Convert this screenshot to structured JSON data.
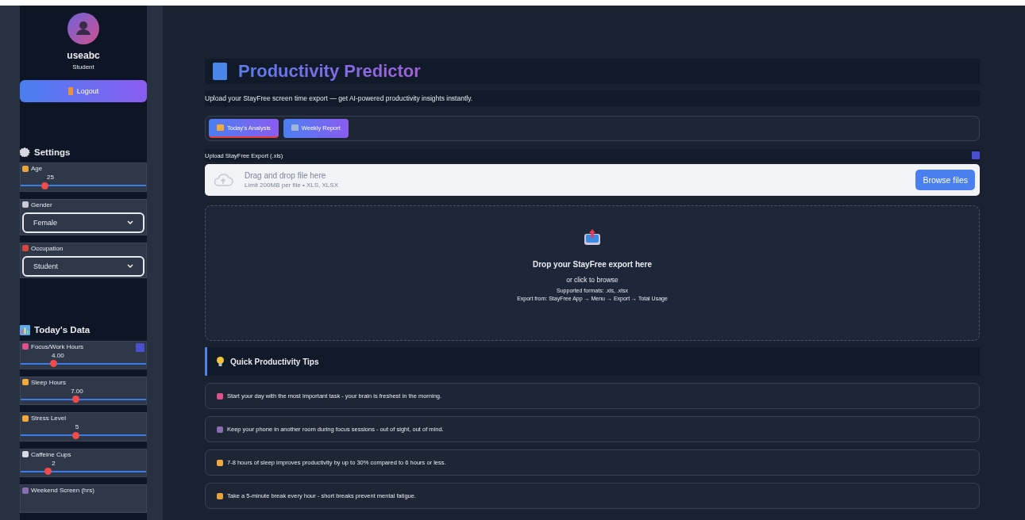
{
  "sidebar": {
    "user": {
      "name": "useabc",
      "role": "Student"
    },
    "logout": "Logout",
    "settings": {
      "title": "Settings",
      "fields": [
        {
          "kind": "slider",
          "label": "Age",
          "reading": "25",
          "level": 0.19
        },
        {
          "kind": "select",
          "label": "Gender",
          "value": "Female"
        },
        {
          "kind": "select",
          "label": "Occupation",
          "value": "Student"
        }
      ]
    },
    "today": {
      "title": "Today's Data",
      "fields": [
        {
          "kind": "slider",
          "label": "Focus/Work Hours",
          "reading": "4.00",
          "level": 0.26,
          "help": true
        },
        {
          "kind": "slider",
          "label": "Sleep Hours",
          "reading": "7.00",
          "level": 0.44
        },
        {
          "kind": "slider",
          "label": "Stress Level",
          "reading": "5",
          "level": 0.44
        },
        {
          "kind": "slider",
          "label": "Caffeine Cups",
          "reading": "2",
          "level": 0.22
        },
        {
          "kind": "slider",
          "label": "Weekend Screen (hrs)"
        }
      ]
    }
  },
  "main": {
    "title": "Productivity Predictor",
    "subtitle": "Upload your StayFree screen time export — get AI-powered productivity insights instantly.",
    "tabs": [
      {
        "label": "Today's Analysis",
        "selected": true
      },
      {
        "label": "Weekly Report",
        "selected": false
      }
    ],
    "uploader": {
      "label": "Upload StayFree Export (.xls)",
      "hint": "Drag and drop file here",
      "limit": "Limit 200MB per file • XLS, XLSX",
      "button": "Browse files"
    },
    "dropzone": {
      "title": "Drop your StayFree export here",
      "sub": "or click to browse",
      "formats": "Supported formats: .xls, .xlsx",
      "source": "Export from: StayFree App → Menu → Export → Total Usage"
    },
    "tips": {
      "title": "Quick Productivity Tips",
      "items": [
        "Start your day with the most important task - your brain is freshest in the morning.",
        "Keep your phone in another room during focus sessions - out of sight, out of mind.",
        "7-8 hours of sleep improves productivity by up to 30% compared to 6 hours or less.",
        "Take a 5-minute break every hour - short breaks prevent mental fatigue."
      ]
    }
  }
}
